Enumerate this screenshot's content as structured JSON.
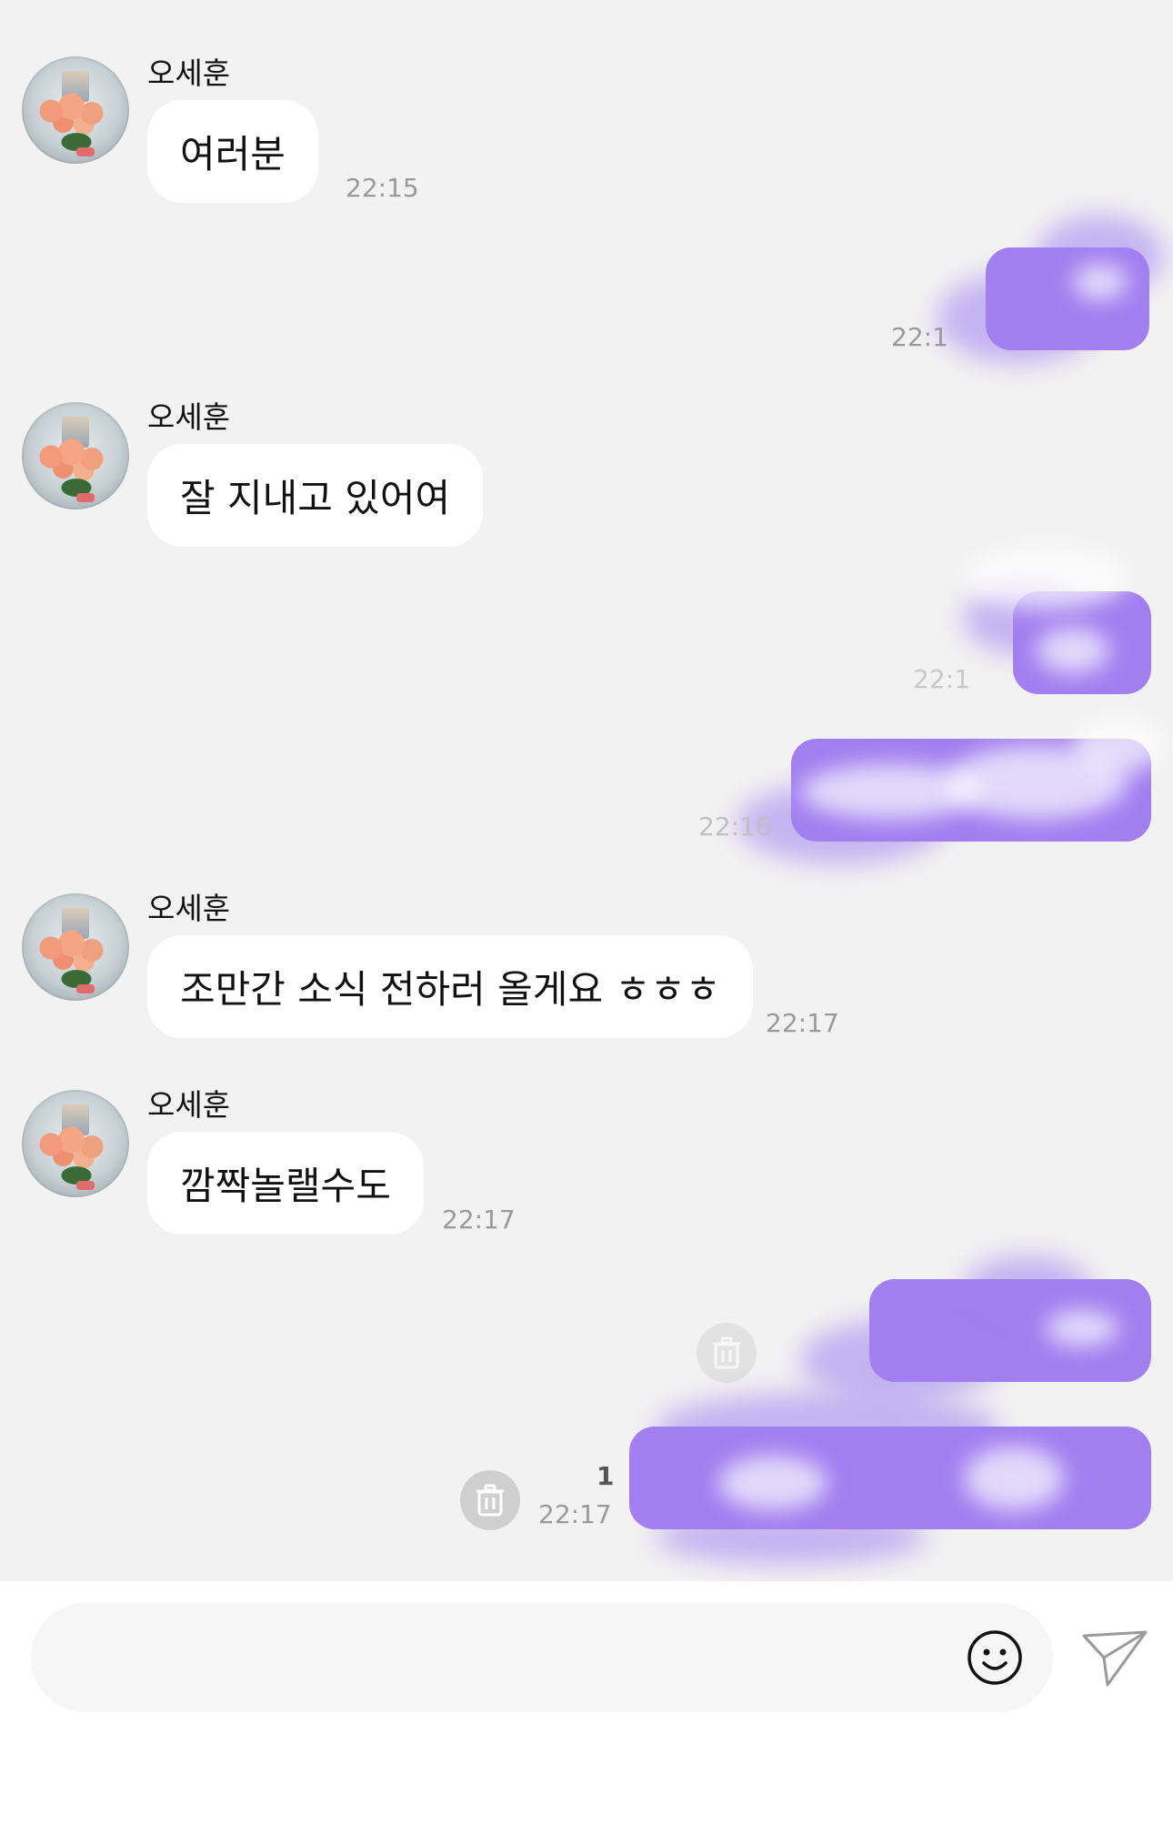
{
  "chat": {
    "sender_name": "오세훈",
    "messages": [
      {
        "side": "in",
        "text": "여러분",
        "time": "22:15"
      },
      {
        "side": "out",
        "time": "22:1"
      },
      {
        "side": "in",
        "text": "잘 지내고 있어여"
      },
      {
        "side": "out",
        "time": "22:1"
      },
      {
        "side": "out",
        "time": "22:16"
      },
      {
        "side": "in",
        "text": "조만간 소식 전하러 올게요 ㅎㅎㅎ",
        "time": "22:17"
      },
      {
        "side": "in",
        "text": "깜짝놀랠수도",
        "time": "22:17"
      },
      {
        "side": "out"
      },
      {
        "side": "out",
        "time": "22:17",
        "unread": "1"
      }
    ]
  },
  "composer": {
    "placeholder": "",
    "emoji_icon": "smiley-face-icon",
    "send_icon": "paper-plane-icon"
  },
  "colors": {
    "background": "#f2f2f2",
    "incoming_bubble": "#ffffff",
    "outgoing_bubble": "#a27ff0",
    "timestamp": "#9a9a9a"
  }
}
